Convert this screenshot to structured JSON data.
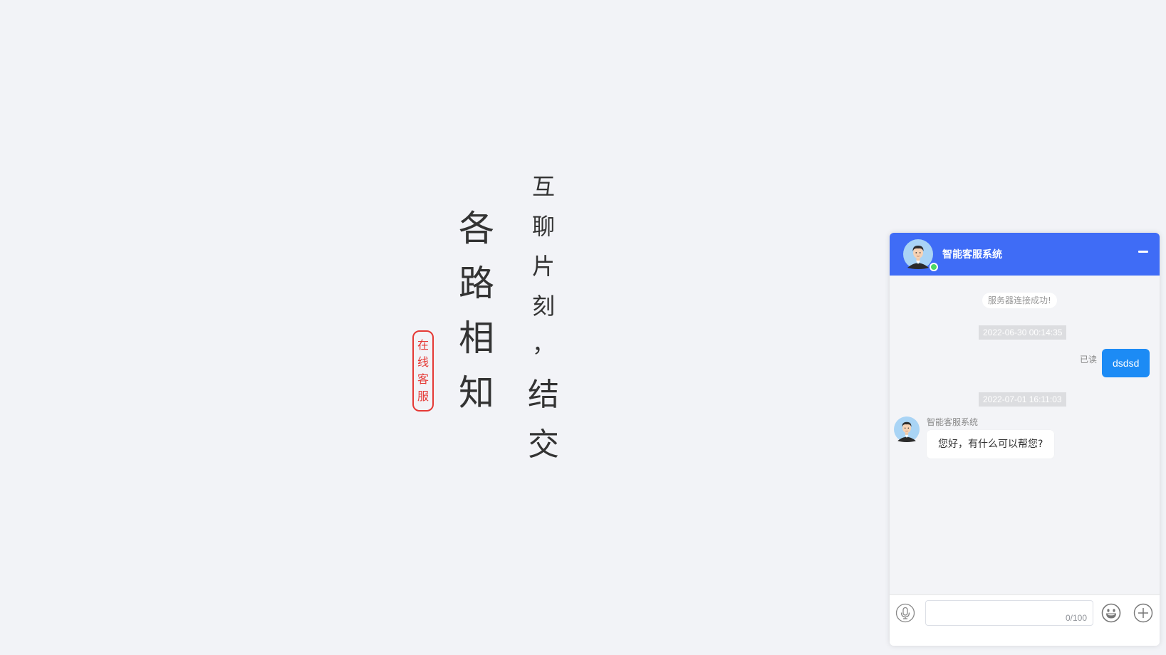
{
  "poem": {
    "line_right": [
      "互",
      "聊",
      "片",
      "刻",
      "，",
      "结",
      "交"
    ],
    "line_left": [
      "各",
      "路",
      "相",
      "知"
    ]
  },
  "seal": {
    "chars": [
      "在",
      "线",
      "客",
      "服"
    ]
  },
  "chat": {
    "title": "智能客服系统",
    "status": "online",
    "system_message": "服务器连接成功!",
    "messages": [
      {
        "timestamp": "2022-06-30 00:14:35",
        "direction": "out",
        "text": "dsdsd",
        "read_label": "已读"
      },
      {
        "timestamp": "2022-07-01 16:11:03",
        "direction": "in",
        "sender": "智能客服系统",
        "text": "您好，有什么可以帮您?"
      }
    ],
    "input": {
      "value": "",
      "placeholder": "",
      "char_count": "0/100"
    }
  },
  "colors": {
    "header": "#3f6cf6",
    "outgoing_bubble": "#1c8bf5",
    "seal": "#e53935",
    "online": "#4cd964"
  },
  "icons": {
    "minimize": "minimize-icon",
    "voice": "microphone-icon",
    "emoji": "emoji-icon",
    "more": "plus-circle-icon"
  }
}
